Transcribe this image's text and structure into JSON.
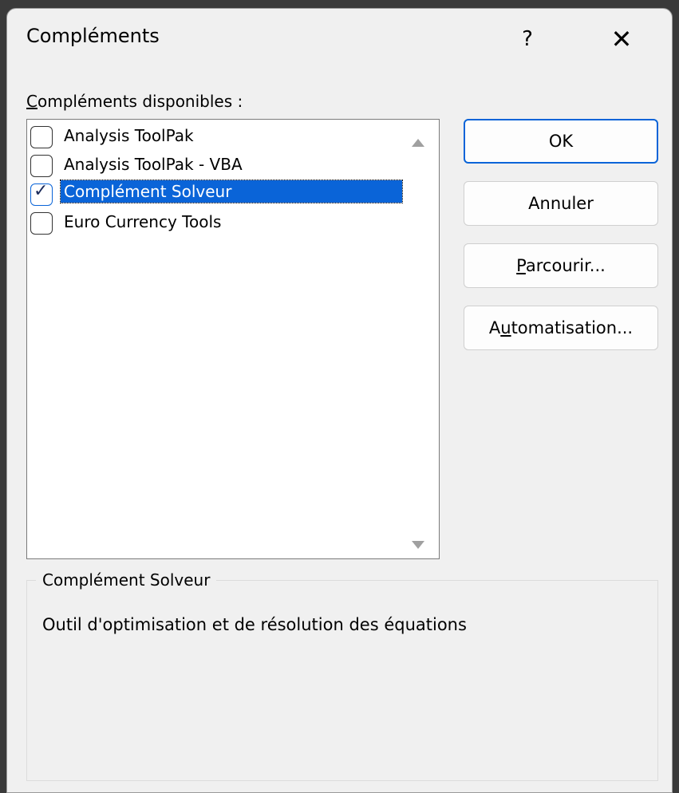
{
  "dialog": {
    "title": "Compléments",
    "help_label": "?",
    "close_label": "✕"
  },
  "available": {
    "label_accel": "C",
    "label_rest": "ompléments disponibles :",
    "items": [
      {
        "label": "Analysis ToolPak",
        "checked": false
      },
      {
        "label": "Analysis ToolPak - VBA",
        "checked": false
      },
      {
        "label": "Complément Solveur",
        "checked": true
      },
      {
        "label": "Euro Currency Tools",
        "checked": false
      }
    ],
    "checkmark": "✓"
  },
  "buttons": {
    "ok": "OK",
    "cancel": "Annuler",
    "browse_accel": "P",
    "browse_rest": "arcourir...",
    "automation_pre": "A",
    "automation_accel": "u",
    "automation_rest": "tomatisation..."
  },
  "description": {
    "title": "Complément Solveur",
    "text": "Outil d'optimisation et de résolution des équations"
  },
  "colors": {
    "selection": "#0a64d8",
    "dialog_bg": "#f0f0f0"
  }
}
